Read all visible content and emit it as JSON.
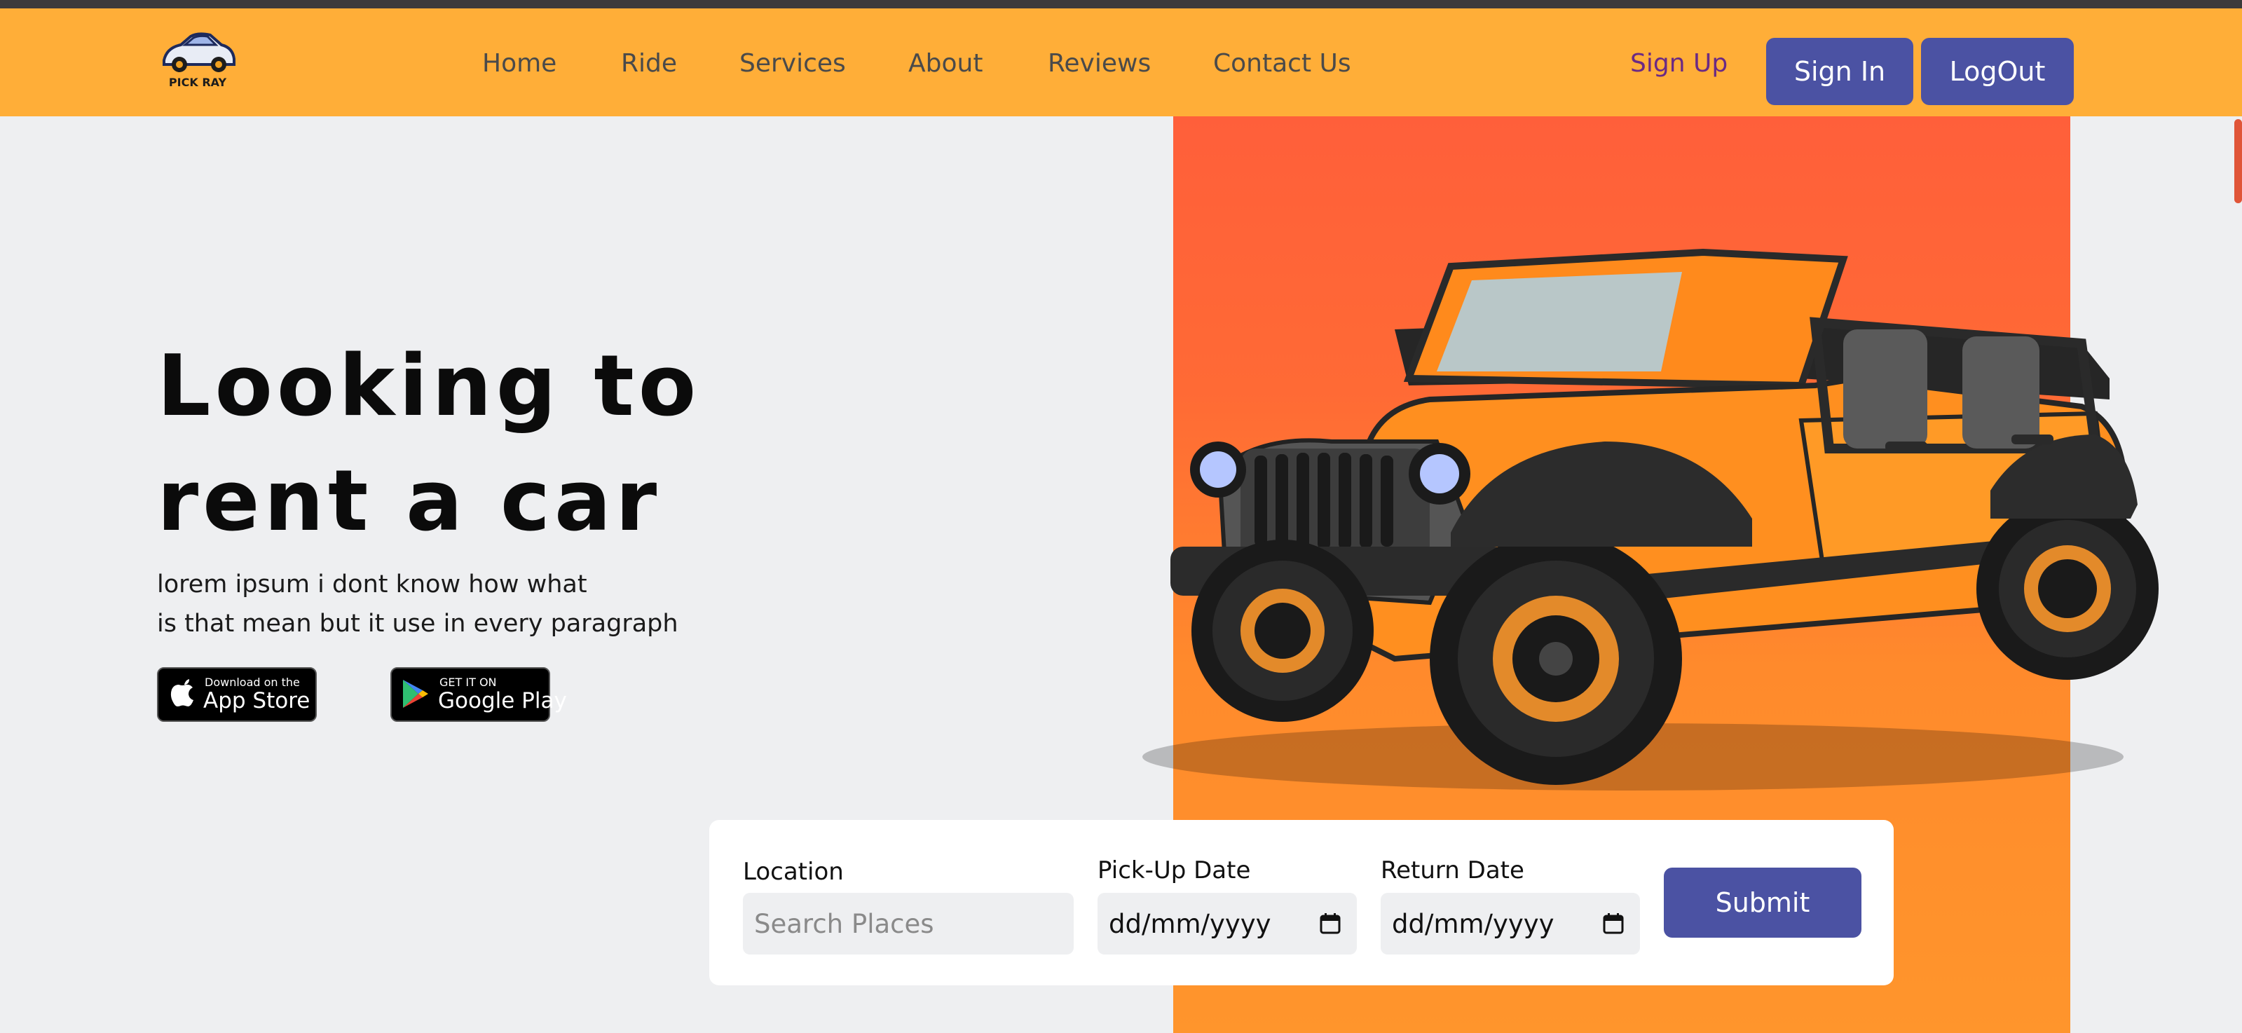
{
  "brand": {
    "logo_text": "PICK RAY"
  },
  "nav": {
    "links": [
      "Home",
      "Ride",
      "Services",
      "About",
      "Reviews",
      "Contact Us"
    ],
    "sign_up": "Sign Up",
    "sign_in": "Sign In",
    "log_out": "LogOut"
  },
  "hero": {
    "headline_line1": "Looking to",
    "headline_line2": "rent a car",
    "description_line1": "lorem ipsum i dont know how what",
    "description_line2": "is that mean but it use in every paragraph",
    "app_store": {
      "small": "Download on the",
      "big": "App Store"
    },
    "google_play": {
      "small": "GET IT ON",
      "big": "Google Play"
    }
  },
  "booking": {
    "location_label": "Location",
    "location_placeholder": "Search Places",
    "pickup_label": "Pick-Up Date",
    "pickup_value": "dd/mm/yyyy",
    "return_label": "Return Date",
    "return_value": "dd/mm/yyyy",
    "submit_label": "Submit"
  },
  "colors": {
    "nav_bg": "#ffae38",
    "accent_blue": "#4b52a3",
    "hero_orange": "#ff6a35",
    "signup_purple": "#6b2a84"
  },
  "icons": [
    "car-logo-icon",
    "apple-icon",
    "google-play-icon",
    "calendar-icon",
    "jeep-image"
  ]
}
